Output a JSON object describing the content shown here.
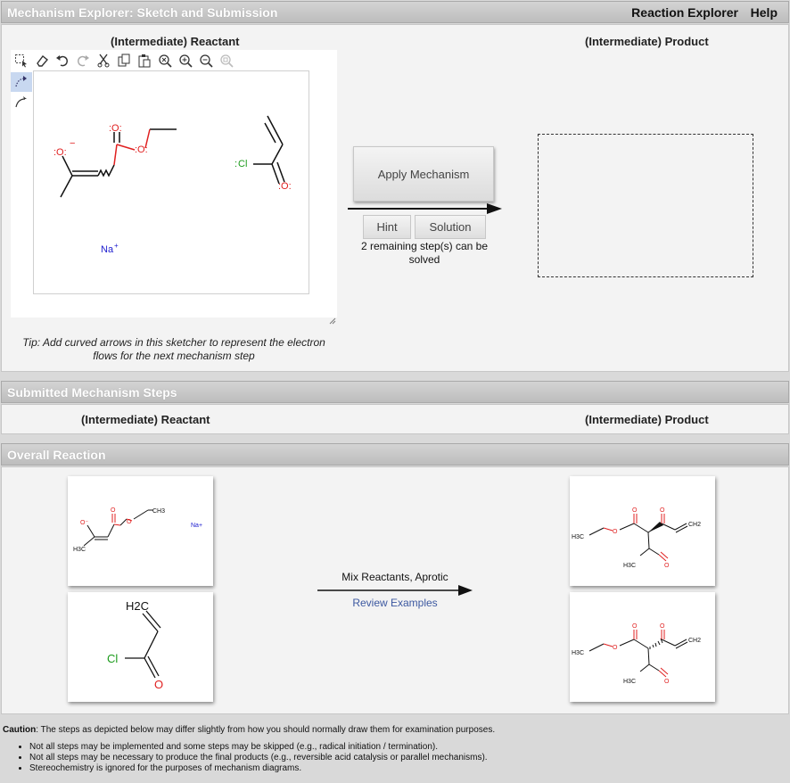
{
  "header": {
    "title": "Mechanism Explorer: Sketch and Submission",
    "nav": [
      "Reaction Explorer",
      "Help"
    ]
  },
  "sketch": {
    "reactant_title": "(Intermediate) Reactant",
    "product_title": "(Intermediate) Product",
    "toolbar_icons": [
      "select-icon",
      "eraser-icon",
      "undo-icon",
      "redo-icon",
      "cut-icon",
      "copy-icon",
      "paste-icon",
      "zoom-reset-icon",
      "zoom-in-icon",
      "zoom-out-icon",
      "zoom-fit-icon"
    ],
    "canvas_labels": {
      "na": "Na",
      "na_charge": "+",
      "cl": "Cl"
    },
    "tip": "Tip: Add curved arrows in this sketcher to represent the electron flows for the next mechanism step",
    "apply_label": "Apply Mechanism",
    "hint_label": "Hint",
    "solution_label": "Solution",
    "remaining_text": "2 remaining step(s) can be solved"
  },
  "submitted": {
    "title": "Submitted Mechanism Steps",
    "reactant_title": "(Intermediate) Reactant",
    "product_title": "(Intermediate) Product"
  },
  "overall": {
    "title": "Overall Reaction",
    "conditions": "Mix Reactants, Aprotic",
    "review_link": "Review Examples",
    "labels": {
      "ch3": "CH3",
      "h3c": "H3C",
      "na": "Na+",
      "h2c": "H2C",
      "cl": "Cl",
      "o": "O",
      "ch2": "CH2"
    }
  },
  "caution": {
    "label": "Caution",
    "text": ": The steps as depicted below may differ slightly from how you should normally draw them for examination purposes.",
    "items": [
      "Not all steps may be implemented and some steps may be skipped (e.g., radical initiation / termination).",
      "Not all steps may be necessary to produce the final products (e.g., reversible acid catalysis or parallel mechanisms).",
      "Stereochemistry is ignored for the purposes of mechanism diagrams."
    ]
  },
  "colors": {
    "oxygen": "#e02020",
    "chlorine": "#1a9a1a",
    "sodium": "#2020d0",
    "link": "#3c58a0"
  }
}
